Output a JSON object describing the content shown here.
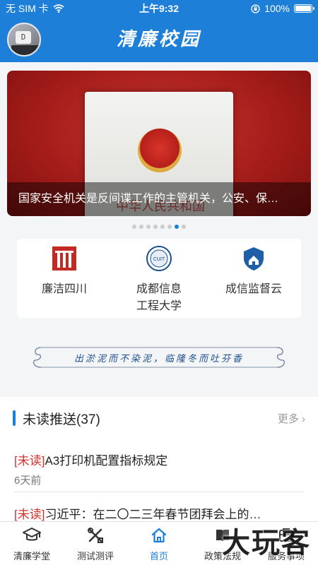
{
  "status": {
    "carrier": "无 SIM 卡",
    "time": "上午9:32",
    "battery": "100%",
    "battery_level": 1.0
  },
  "header": {
    "title": "清廉校园",
    "avatar_key": "D"
  },
  "banner": {
    "caption": "国家安全机关是反间谍工作的主管机关，公安、保…",
    "book_title": "中华人民共和国",
    "slide_count": 8,
    "active_slide": 7
  },
  "links": [
    {
      "label": "廉洁四川",
      "icon": "lianjie-sichuan-logo"
    },
    {
      "label": "成都信息\n工程大学",
      "icon": "cuit-logo"
    },
    {
      "label": "成信监督云",
      "icon": "supervision-cloud-logo"
    }
  ],
  "slogan": "出淤泥而不染泥，临隆冬而吐芬香",
  "unread": {
    "title": "未读推送(37)",
    "more": "更多",
    "items": [
      {
        "tag": "[未读]",
        "title": "A3打印机配置指标规定",
        "time": "6天前"
      },
      {
        "tag": "[未读]",
        "title": "习近平：在二〇二三年春节团拜会上的…"
      }
    ]
  },
  "tabs": [
    {
      "label": "清廉学堂",
      "icon": "graduation-cap-icon",
      "active": false
    },
    {
      "label": "测试测评",
      "icon": "tools-icon",
      "active": false
    },
    {
      "label": "首页",
      "icon": "home-icon",
      "active": true
    },
    {
      "label": "政策法规",
      "icon": "book-icon",
      "active": false
    },
    {
      "label": "服务事项",
      "icon": "service-icon",
      "active": false
    }
  ],
  "watermark": "大玩客",
  "colors": {
    "primary": "#1e7fd8",
    "unread_tag": "#d9312a"
  }
}
